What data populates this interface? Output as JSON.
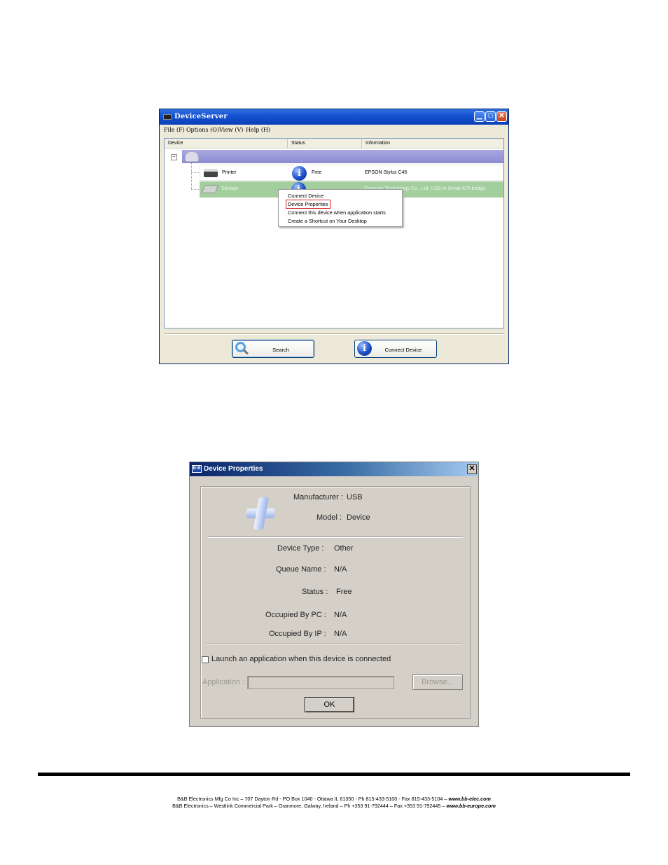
{
  "device_server": {
    "title": "DeviceServer",
    "menu": [
      "File (F)",
      "Options (O)",
      "View (V)",
      "Help (H)"
    ],
    "columns": [
      "Device",
      "Status",
      "Information"
    ],
    "devices": [
      {
        "name": "Printer",
        "status": "Free",
        "info": "EPSON Stylus C45"
      },
      {
        "name": "Storage",
        "status": "",
        "info": "Genesys Technology Co., Ltd. USB to Serial-ATA bridge"
      }
    ],
    "context_menu": [
      "Connect Device",
      "Device Properties",
      "Connect this device when application starts",
      "Create a Shortcut on Your Desktop"
    ],
    "buttons": {
      "search": "Search",
      "connect": "Connect Device"
    }
  },
  "device_properties": {
    "title": "Device Properties",
    "icon_badge": "B·B",
    "manufacturer_label": "Manufacturer :",
    "manufacturer": "USB",
    "model_label": "Model :",
    "model": "Device",
    "rows": [
      {
        "label": "Device Type :",
        "value": "Other"
      },
      {
        "label": "Queue Name :",
        "value": "N/A"
      },
      {
        "label": "Status :",
        "value": "Free"
      },
      {
        "label": "Occupied By PC :",
        "value": "N/A"
      },
      {
        "label": "Occupied By IP :",
        "value": "N/A"
      }
    ],
    "launch_label": "Launch an application when this device is connected",
    "application_label": "Application :",
    "browse_label": "Browse...",
    "ok_label": "OK"
  },
  "footer": {
    "line1": "B&B Electronics Mfg Co Inc – 707 Dayton Rd - PO Box 1040 - Ottawa IL 61350 - Ph 815-433-5100 - Fax 815-433-5104 – ",
    "line1_web": "www.bb-elec.com",
    "line2": "B&B Electronics – Westlink Commercial Park – Oranmore, Galway, Ireland – Ph +353 91-792444 – Fax +353 91-792445 – ",
    "line2_web": "www.bb-europe.com"
  },
  "colors": {
    "titlebar_xp": "#1451d0",
    "group_row": "#8c8bd2",
    "selected_row": "#a3cf9f",
    "dialog_bg": "#d4d0c8",
    "highlight_box": "#d11f1f"
  }
}
